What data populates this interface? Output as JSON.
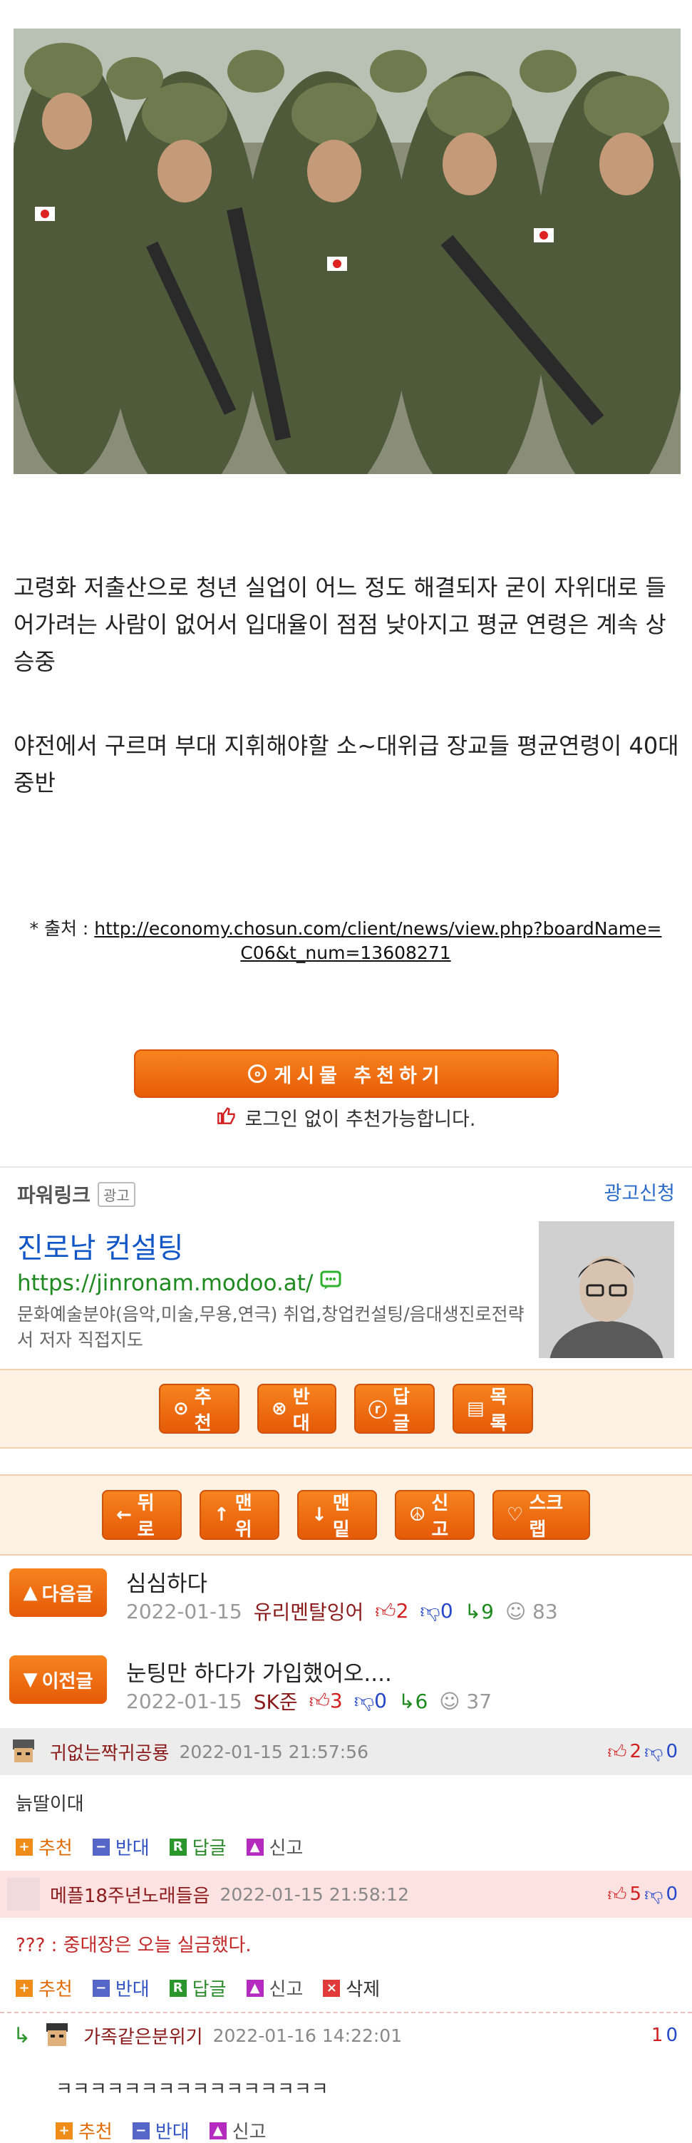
{
  "photo": {
    "alt_name": "soldiers-photo"
  },
  "article": {
    "paragraph1": "고령화 저출산으로 청년 실업이 어느 정도 해결되자 굳이 자위대로 들어가려는 사람이 없어서 입대율이 점점 낮아지고 평균 연령은 계속 상승중",
    "paragraph2": "야전에서 구르며 부대 지휘해야할 소~대위급 장교들 평균연령이 40대 중반",
    "source_prefix": "* 출처 : ",
    "source_url": "http://economy.chosun.com/client/news/view.php?boardName=C06&t_num=13608271"
  },
  "recommend": {
    "button_label": "게시물 추천하기",
    "login_note": "로그인 없이 추천가능합니다."
  },
  "ad": {
    "header": "파워링크",
    "badge": "광고",
    "apply_link": "광고신청",
    "title": "진로남 컨설팅",
    "url": "https://jinronam.modoo.at/",
    "description": "문화예술분야(음악,미술,무용,연극) 취업,창업컨설팅/음대생진로전략서 저자 직접지도"
  },
  "action_bar": {
    "recommend": "추천",
    "oppose": "반대",
    "reply": "답글",
    "list": "목록"
  },
  "nav_bar": {
    "back": "뒤로",
    "top": "맨위",
    "bottom": "맨밑",
    "report": "신고",
    "scrap": "스크랩"
  },
  "next_post": {
    "label": "다음글",
    "title": "심심하다",
    "date": "2022-01-15",
    "author": "유리멘탈잉어",
    "up": "2",
    "down": "0",
    "replies": "9",
    "views": "83"
  },
  "prev_post": {
    "label": "이전글",
    "title": "눈팅만 하다가 가입했어오....",
    "date": "2022-01-15",
    "author": "SK준",
    "up": "3",
    "down": "0",
    "replies": "6",
    "views": "37"
  },
  "comments": [
    {
      "author": "귀없는짝귀공룡",
      "time": "2022-01-15 21:57:56",
      "up": "2",
      "down": "0",
      "text": "늙딸이대",
      "actions": [
        "추천",
        "반대",
        "답글",
        "신고"
      ]
    },
    {
      "author": "메플18주년노래들음",
      "time": "2022-01-15 21:58:12",
      "up": "5",
      "down": "0",
      "text": "??? : 중대장은 오늘 실금했다.",
      "actions": [
        "추천",
        "반대",
        "답글",
        "신고",
        "삭제"
      ]
    },
    {
      "author": "가족같은분위기",
      "time": "2022-01-16 14:22:01",
      "up": "1",
      "down": "0",
      "text": "ㅋㅋㅋㅋㅋㅋㅋㅋㅋㅋㅋㅋㅋㅋㅋㅋ",
      "actions": [
        "추천",
        "반대",
        "신고"
      ]
    }
  ],
  "colors": {
    "accent_orange": "#e85c07",
    "link_blue": "#1156c7",
    "url_green": "#1f8a1f",
    "author_red": "#8b1a1a"
  }
}
